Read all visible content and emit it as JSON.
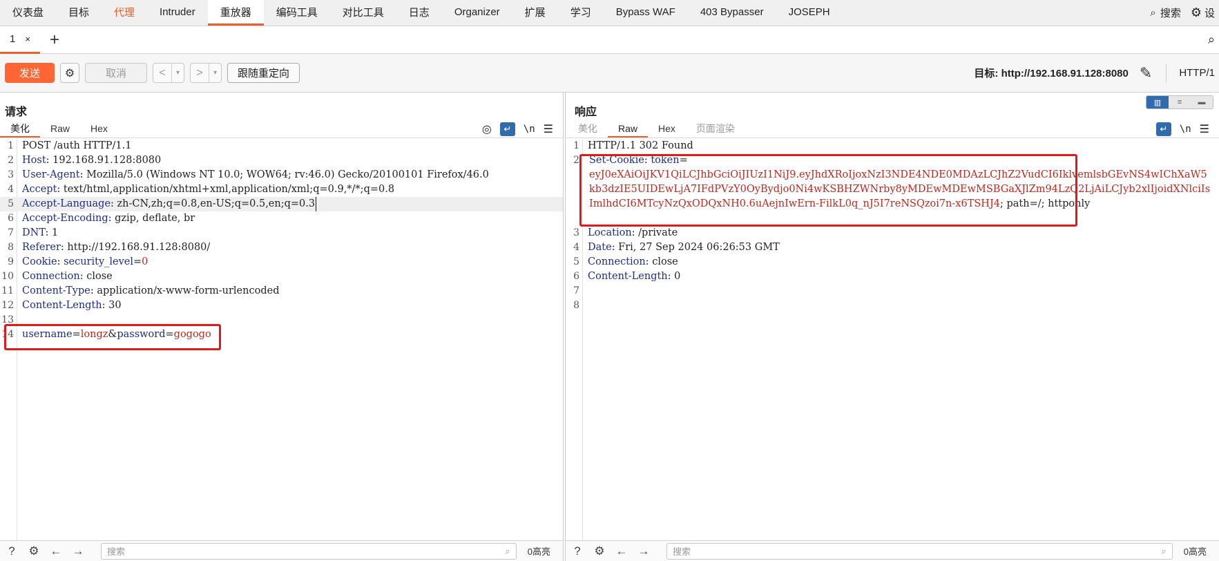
{
  "nav": {
    "tabs": [
      "仪表盘",
      "目标",
      "代理",
      "Intruder",
      "重放器",
      "编码工具",
      "对比工具",
      "日志",
      "Organizer",
      "扩展",
      "学习",
      "Bypass WAF",
      "403 Bypasser",
      "JOSEPH"
    ],
    "active": "重放器",
    "highlighted": "代理",
    "search_label": "搜索",
    "settings_label": "设"
  },
  "tabrow": {
    "tab_label": "1",
    "close": "×",
    "add": "+"
  },
  "toolbar": {
    "send": "发送",
    "cancel": "取消",
    "back": "<",
    "forward": ">",
    "dropdown": "▾",
    "follow_redirect": "跟随重定向",
    "target": "目标: http://192.168.91.128:8080",
    "protocol": "HTTP/1"
  },
  "request": {
    "title": "请求",
    "tabs": [
      "美化",
      "Raw",
      "Hex"
    ],
    "active_tab": "美化",
    "newline_toggle": "\\n",
    "lines": [
      {
        "n": "1",
        "parts": [
          {
            "t": "POST /auth HTTP/1.1",
            "c": "v"
          }
        ]
      },
      {
        "n": "2",
        "parts": [
          {
            "t": "Host",
            "c": "k"
          },
          {
            "t": ": 192.168.91.128:8080",
            "c": "v"
          }
        ]
      },
      {
        "n": "3",
        "parts": [
          {
            "t": "User-Agent",
            "c": "k"
          },
          {
            "t": ": Mozilla/5.0 (Windows NT 10.0; WOW64; rv:46.0) Gecko/20100101 Firefox/46.0",
            "c": "v"
          }
        ]
      },
      {
        "n": "4",
        "parts": [
          {
            "t": "Accept",
            "c": "k"
          },
          {
            "t": ": text/html,application/xhtml+xml,application/xml;q=0.9,*/*;q=0.8",
            "c": "v"
          }
        ]
      },
      {
        "n": "5",
        "parts": [
          {
            "t": "Accept-Language",
            "c": "k"
          },
          {
            "t": ": zh-CN,zh;q=0.8,en-US;q=0.5,en;q=0.3",
            "c": "v"
          }
        ],
        "cursor": true
      },
      {
        "n": "6",
        "parts": [
          {
            "t": "Accept-Encoding",
            "c": "k"
          },
          {
            "t": ": gzip, deflate, br",
            "c": "v"
          }
        ]
      },
      {
        "n": "7",
        "parts": [
          {
            "t": "DNT",
            "c": "k"
          },
          {
            "t": ": 1",
            "c": "v"
          }
        ]
      },
      {
        "n": "8",
        "parts": [
          {
            "t": "Referer",
            "c": "k"
          },
          {
            "t": ": http://192.168.91.128:8080/",
            "c": "v"
          }
        ]
      },
      {
        "n": "9",
        "parts": [
          {
            "t": "Cookie",
            "c": "k"
          },
          {
            "t": ": ",
            "c": "v"
          },
          {
            "t": "security_level",
            "c": "k"
          },
          {
            "t": "=",
            "c": "v"
          },
          {
            "t": "0",
            "c": "r"
          }
        ]
      },
      {
        "n": "10",
        "parts": [
          {
            "t": "Connection",
            "c": "k"
          },
          {
            "t": ": close",
            "c": "v"
          }
        ]
      },
      {
        "n": "11",
        "parts": [
          {
            "t": "Content-Type",
            "c": "k"
          },
          {
            "t": ": application/x-www-form-urlencoded",
            "c": "v"
          }
        ]
      },
      {
        "n": "12",
        "parts": [
          {
            "t": "Content-Length",
            "c": "k"
          },
          {
            "t": ": 30",
            "c": "v"
          }
        ]
      },
      {
        "n": "13",
        "parts": []
      },
      {
        "n": "14",
        "parts": [
          {
            "t": "username",
            "c": "k"
          },
          {
            "t": "=",
            "c": "v"
          },
          {
            "t": "longz",
            "c": "r"
          },
          {
            "t": "&",
            "c": "v"
          },
          {
            "t": "password",
            "c": "k"
          },
          {
            "t": "=",
            "c": "v"
          },
          {
            "t": "gogogo",
            "c": "r"
          }
        ]
      }
    ],
    "search_placeholder": "搜索",
    "match_count": "0高亮"
  },
  "response": {
    "title": "响应",
    "tabs": [
      "美化",
      "Raw",
      "Hex",
      "页面渲染"
    ],
    "active_tab": "Raw",
    "newline_toggle": "\\n",
    "line1": "HTTP/1.1 302 Found",
    "set_cookie_key": "Set-Cookie",
    "set_cookie_name": "token",
    "set_cookie_value": "eyJ0eXAiOiJKV1QiLCJhbGciOiJIUzI1NiJ9.eyJhdXRoIjoxNzI3NDE4NDE0MDAzLCJhZ2VudCI6IklvemlsbGEvNS4wIChXaW5kb3dzIE5UIDEwLjA7IFdPVzY0OyBydjo0Ni4wKSBHZWNrby8yMDEwMDEwMSBGaXJlZm94LzQ2LjAiLCJyb2xlIjoidXNlciIsImlhdCI6MTcyNzQxODQxNH0.6uAejnIwErn-FilkL0q_nJ5I7reNSQzoi7n-x6TSHJ4",
    "set_cookie_tail": "; path=/; httponly",
    "lines": [
      {
        "n": "3",
        "parts": [
          {
            "t": "Location",
            "c": "k"
          },
          {
            "t": ": /private",
            "c": "v"
          }
        ]
      },
      {
        "n": "4",
        "parts": [
          {
            "t": "Date",
            "c": "k"
          },
          {
            "t": ": Fri, 27 Sep 2024 06:26:53 GMT",
            "c": "v"
          }
        ]
      },
      {
        "n": "5",
        "parts": [
          {
            "t": "Connection",
            "c": "k"
          },
          {
            "t": ": close",
            "c": "v"
          }
        ]
      },
      {
        "n": "6",
        "parts": [
          {
            "t": "Content-Length",
            "c": "k"
          },
          {
            "t": ": 0",
            "c": "v"
          }
        ]
      },
      {
        "n": "7",
        "parts": []
      },
      {
        "n": "8",
        "parts": []
      }
    ],
    "search_placeholder": "搜索",
    "match_count": "0高亮"
  },
  "colors": {
    "accent": "#e8602c",
    "send": "#ff6633",
    "key": "#1d2d8a",
    "value_red": "#c0281e",
    "box": "#e01a1a",
    "toggle": "#2f6bad"
  }
}
